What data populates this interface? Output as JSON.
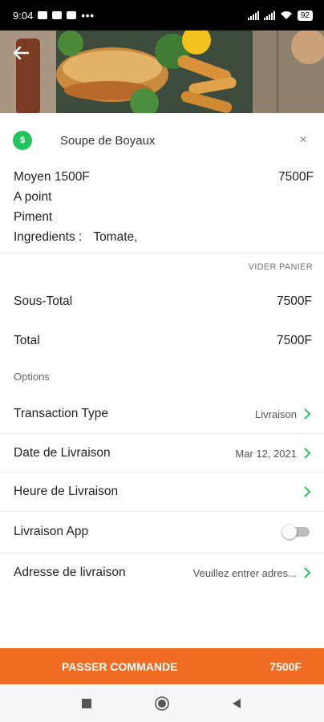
{
  "status_bar": {
    "time": "9:04",
    "dots": "•••",
    "battery": "92"
  },
  "item": {
    "badge": "$",
    "name": "Soupe de Boyaux",
    "close": "×",
    "size_label": "Moyen 1500F",
    "price": "7500F",
    "cooking": "A point",
    "spice": "Piment",
    "ingredients_label": "Ingredients :",
    "ingredients_value": "Tomate,"
  },
  "cart": {
    "clear_label": "VIDER PANIER"
  },
  "summary": {
    "subtotal_label": "Sous-Total",
    "subtotal_value": "7500F",
    "total_label": "Total",
    "total_value": "7500F"
  },
  "options": {
    "heading": "Options",
    "transaction_label": "Transaction Type",
    "transaction_value": "Livraison",
    "date_label": "Date de Livraison",
    "date_value": "Mar 12, 2021",
    "time_label": "Heure de Livraison",
    "time_value": "",
    "app_label": "Livraison App",
    "app_enabled": false,
    "address_label": "Adresse de livraison",
    "address_value": "Veuillez entrer adres..."
  },
  "order": {
    "button_label": "PASSER COMMANDE",
    "price": "7500F"
  },
  "colors": {
    "accent_green": "#22c35e",
    "order_orange": "#ef6c22"
  }
}
